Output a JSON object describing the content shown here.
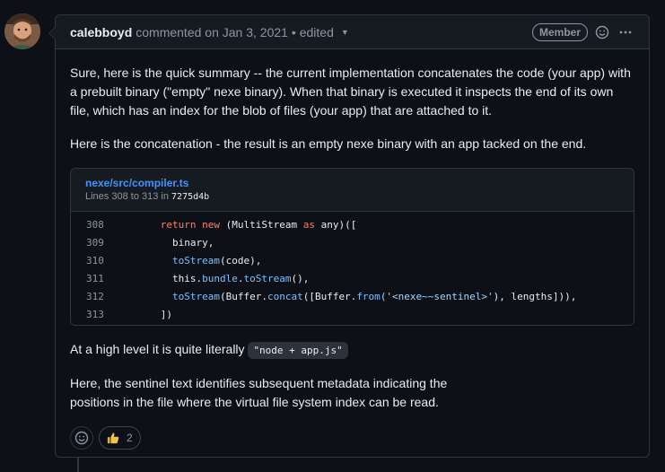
{
  "comment": {
    "author": "calebboyd",
    "action": "commented on",
    "date": "Jan 3, 2021",
    "separator": "•",
    "edited": "edited",
    "badge": "Member",
    "paragraphs": [
      "Sure, here is the quick summary -- the current implementation concatenates the code (your app) with a prebuilt binary (\"empty\" nexe binary). When that binary is executed it inspects the end of its own file, which has an index for the blob of files (your app) that are attached to it.",
      "Here is the concatenation - the result is an empty nexe binary with an app tacked on the end."
    ],
    "code_ref": {
      "path": "nexe/src/compiler.ts",
      "lines_label": "Lines 308 to 313 in",
      "sha": "7275d4b",
      "lines": [
        {
          "num": "308",
          "tokens": [
            {
              "t": "      ",
              "c": ""
            },
            {
              "t": "return",
              "c": "kw"
            },
            {
              "t": " ",
              "c": ""
            },
            {
              "t": "new",
              "c": "kw"
            },
            {
              "t": " (MultiStream ",
              "c": ""
            },
            {
              "t": "as",
              "c": "kw"
            },
            {
              "t": " any)([",
              "c": ""
            }
          ]
        },
        {
          "num": "309",
          "tokens": [
            {
              "t": "        binary,",
              "c": ""
            }
          ]
        },
        {
          "num": "310",
          "tokens": [
            {
              "t": "        ",
              "c": ""
            },
            {
              "t": "toStream",
              "c": "pr"
            },
            {
              "t": "(code),",
              "c": ""
            }
          ]
        },
        {
          "num": "311",
          "tokens": [
            {
              "t": "        this.",
              "c": ""
            },
            {
              "t": "bundle",
              "c": "pr"
            },
            {
              "t": ".",
              "c": ""
            },
            {
              "t": "toStream",
              "c": "pr"
            },
            {
              "t": "(),",
              "c": ""
            }
          ]
        },
        {
          "num": "312",
          "tokens": [
            {
              "t": "        ",
              "c": ""
            },
            {
              "t": "toStream",
              "c": "pr"
            },
            {
              "t": "(Buffer.",
              "c": ""
            },
            {
              "t": "concat",
              "c": "pr"
            },
            {
              "t": "([Buffer.",
              "c": ""
            },
            {
              "t": "from",
              "c": "pr"
            },
            {
              "t": "('<nexe~~sentinel>'",
              "c": "st"
            },
            {
              "t": "), lengths])),",
              "c": ""
            }
          ]
        },
        {
          "num": "313",
          "tokens": [
            {
              "t": "      ])",
              "c": ""
            }
          ]
        }
      ]
    },
    "high_level_text": "At a high level it is quite literally",
    "inline_code": "\"node + app.js\"",
    "closing_line_1": "Here, the sentinel text identifies subsequent metadata indicating the",
    "closing_line_2": "positions in the file where the virtual file system index can be read.",
    "reactions": [
      {
        "emoji": "thumbs-up",
        "count": "2"
      }
    ]
  }
}
